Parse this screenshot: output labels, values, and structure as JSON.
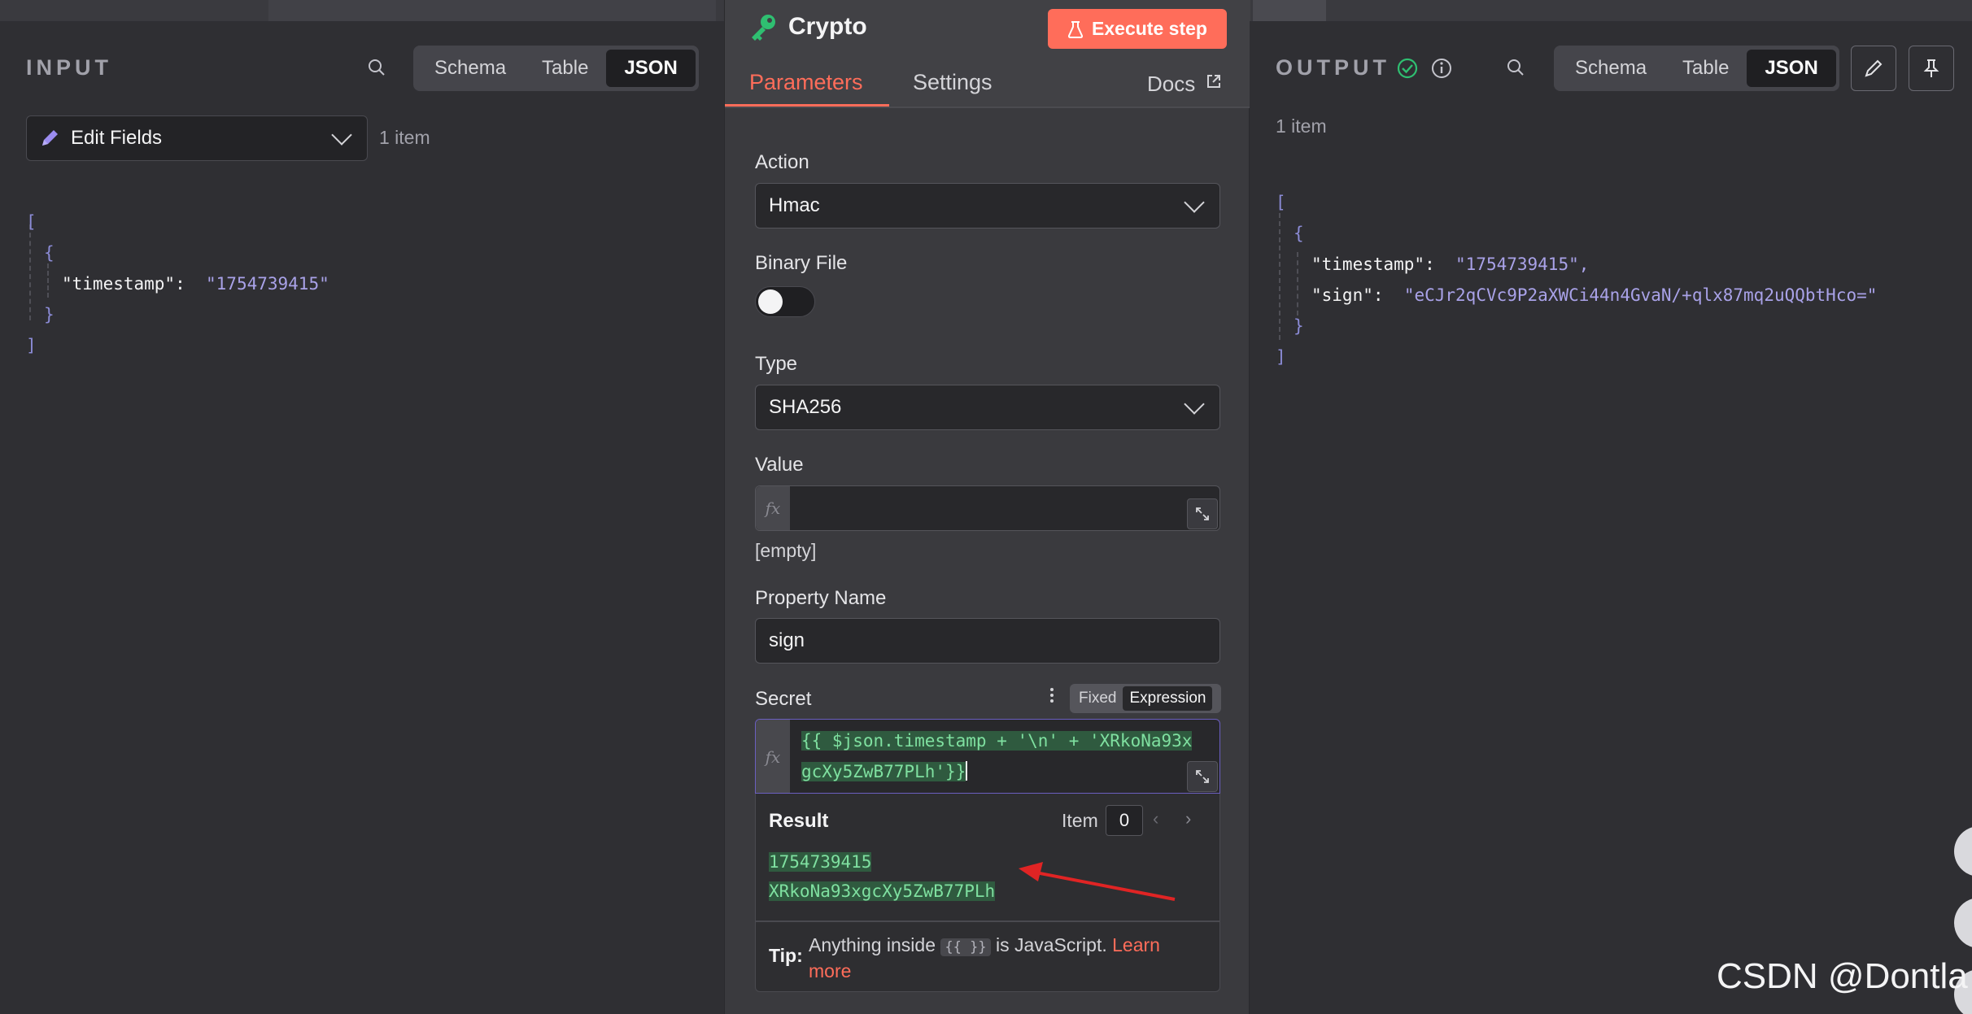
{
  "input": {
    "title": "INPUT",
    "views": [
      "Schema",
      "Table",
      "JSON"
    ],
    "active_view": "JSON",
    "node_select": "Edit Fields",
    "item_count": "1 item",
    "json": {
      "open": "[",
      "obj_open": "{",
      "key": "\"timestamp\":",
      "value": "\"1754739415\"",
      "obj_close": "}",
      "close": "]"
    }
  },
  "node": {
    "title": "Crypto",
    "execute_label": "Execute step",
    "tabs": [
      "Parameters",
      "Settings"
    ],
    "active_tab": "Parameters",
    "docs_label": "Docs",
    "action_label": "Action",
    "action_value": "Hmac",
    "binary_label": "Binary File",
    "binary_on": false,
    "type_label": "Type",
    "type_value": "SHA256",
    "value_label": "Value",
    "value_empty": "[empty]",
    "property_label": "Property Name",
    "property_value": "sign",
    "secret_label": "Secret",
    "mode_fixed": "Fixed",
    "mode_expression": "Expression",
    "secret_line1": "{{ $json.timestamp + '\\n' + 'XRkoNa93x",
    "secret_line2": "gcXy5ZwB77PLh'}}",
    "result_label": "Result",
    "item_label": "Item",
    "item_index": "0",
    "result_line1": "1754739415",
    "result_line2": "XRkoNa93xgcXy5ZwB77PLh",
    "tip_label": "Tip:",
    "tip_text": "Anything inside",
    "tip_code": "{{ }}",
    "tip_text2": "is JavaScript.",
    "tip_link1": "Learn",
    "tip_link2": "more",
    "fx": "fx"
  },
  "output": {
    "title": "OUTPUT",
    "views": [
      "Schema",
      "Table",
      "JSON"
    ],
    "active_view": "JSON",
    "item_count": "1 item",
    "json": {
      "open": "[",
      "obj_open": "{",
      "key1": "\"timestamp\":",
      "value1": "\"1754739415\",",
      "key2": "\"sign\":",
      "value2": "\"eCJr2qCVc9P2aXWCi44n4GvaN/+qlx87mq2uQQbtHco=\"",
      "obj_close": "}",
      "close": "]"
    }
  },
  "watermark": "CSDN @Dontla",
  "colors": {
    "accent": "#ff6d5a",
    "success": "#2fbf71",
    "annotation_arrow": "#e02424"
  }
}
